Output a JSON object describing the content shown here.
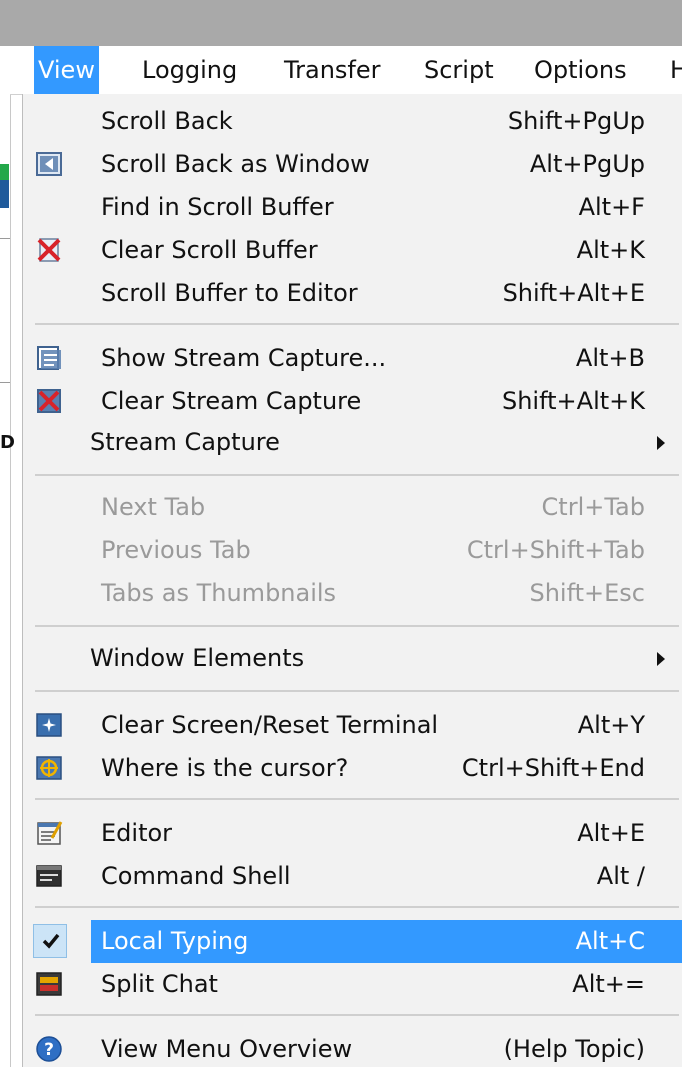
{
  "menubar": {
    "items": [
      {
        "label": "View",
        "mnemonic": "e"
      },
      {
        "label": "Logging"
      },
      {
        "label": "Transfer",
        "mnemonic": "a"
      },
      {
        "label": "Script",
        "mnemonic": "t"
      },
      {
        "label": "Options",
        "mnemonic": "O"
      },
      {
        "label": "H"
      }
    ]
  },
  "view_menu": {
    "scroll_back": {
      "label": "Scroll Back",
      "shortcut": "Shift+PgUp"
    },
    "scroll_back_window": {
      "label": "Scroll Back as Window",
      "shortcut": "Alt+PgUp"
    },
    "find_scroll": {
      "label": "Find in Scroll Buffer",
      "shortcut": "Alt+F"
    },
    "clear_scroll": {
      "label": "Clear Scroll Buffer",
      "shortcut": "Alt+K"
    },
    "scroll_editor": {
      "label": "Scroll Buffer to Editor",
      "shortcut": "Shift+Alt+E"
    },
    "show_stream": {
      "label": "Show Stream Capture...",
      "shortcut": "Alt+B"
    },
    "clear_stream": {
      "label": "Clear Stream Capture",
      "shortcut": "Shift+Alt+K"
    },
    "stream_capture": {
      "label": "Stream Capture"
    },
    "next_tab": {
      "label": "Next Tab",
      "shortcut": "Ctrl+Tab"
    },
    "prev_tab": {
      "label": "Previous Tab",
      "shortcut": "Ctrl+Shift+Tab"
    },
    "tabs_thumbs": {
      "label": "Tabs as Thumbnails",
      "shortcut": "Shift+Esc"
    },
    "window_elements": {
      "label": "Window Elements"
    },
    "clear_screen": {
      "label": "Clear Screen/Reset Terminal",
      "shortcut": "Alt+Y"
    },
    "where_cursor": {
      "label": "Where is the cursor?",
      "shortcut": "Ctrl+Shift+End"
    },
    "editor": {
      "label": "Editor",
      "shortcut": "Alt+E"
    },
    "command_shell": {
      "label": "Command Shell",
      "shortcut": "Alt /"
    },
    "local_typing": {
      "label": "Local Typing",
      "shortcut": "Alt+C",
      "checked": true
    },
    "split_chat": {
      "label": "Split Chat",
      "shortcut": "Alt+="
    },
    "overview": {
      "label": "View Menu Overview",
      "shortcut": "(Help Topic)"
    }
  },
  "left_strip": {
    "char": "D"
  },
  "colors": {
    "highlight": "#3399ff",
    "menu_bg": "#f2f2f2",
    "title_bar": "#a9a9a9"
  }
}
